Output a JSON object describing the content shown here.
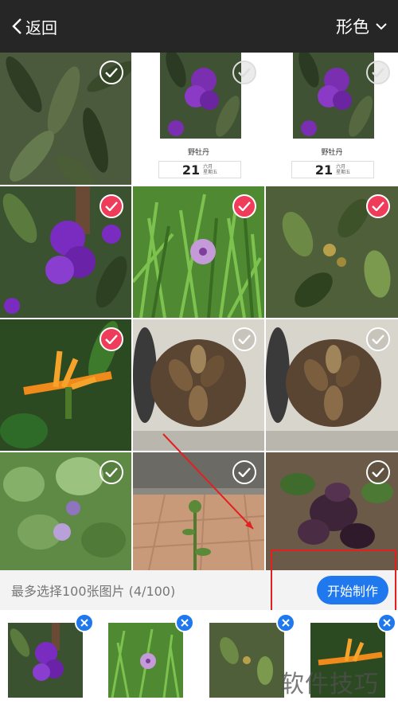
{
  "header": {
    "back_label": "返回",
    "style_label": "形色"
  },
  "grid": {
    "templates": [
      {
        "name": "野牡丹",
        "day": "21",
        "month": "六月",
        "weekday": "星期五"
      },
      {
        "name": "野牡丹",
        "day": "21",
        "month": "六月",
        "weekday": "星期五"
      }
    ],
    "selected_count": 4
  },
  "bottom": {
    "info": "最多选择100张图片 (4/100)",
    "make_button": "开始制作"
  },
  "strip": {
    "count": 4
  },
  "watermark": "软件技巧",
  "colors": {
    "accent": "#1f78ee",
    "selected": "#ef3c5b",
    "topbar": "#262626",
    "annotation": "#e32020"
  }
}
